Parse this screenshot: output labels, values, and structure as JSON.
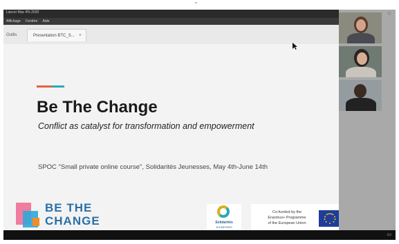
{
  "window": {
    "title_text": "Lancer Mac 4% 2020",
    "menu": [
      "Affichage",
      "Fenêtre",
      "Aide"
    ],
    "tabs": [
      {
        "label": "Outils"
      },
      {
        "label": "Presentation BTC_S..."
      }
    ],
    "tab_close": "×"
  },
  "slide": {
    "title": "Be The Change",
    "subtitle": "Conflict as catalyst for transformation and empowerment",
    "course": "SPOC \"Small private online course\", Solidarités Jeunesses, May 4th-June 14th",
    "accent_colors": [
      "#e8613c",
      "#2aa8b8"
    ]
  },
  "logos": {
    "be_the_change": {
      "line1": "BE THE",
      "line2": "CHANGE"
    },
    "solidarites": {
      "name": "Solidarités",
      "sub": "JEUNESSES"
    },
    "eu": {
      "line1": "Co-funded by the",
      "line2": "Erasmus+ Programme",
      "line3": "of the European Union"
    }
  },
  "participants": [
    {
      "name": "participant-1"
    },
    {
      "name": "participant-2"
    },
    {
      "name": "participant-3"
    }
  ],
  "icons": {
    "cursor": "mouse-pointer-icon",
    "bottom": "screen-icon"
  }
}
